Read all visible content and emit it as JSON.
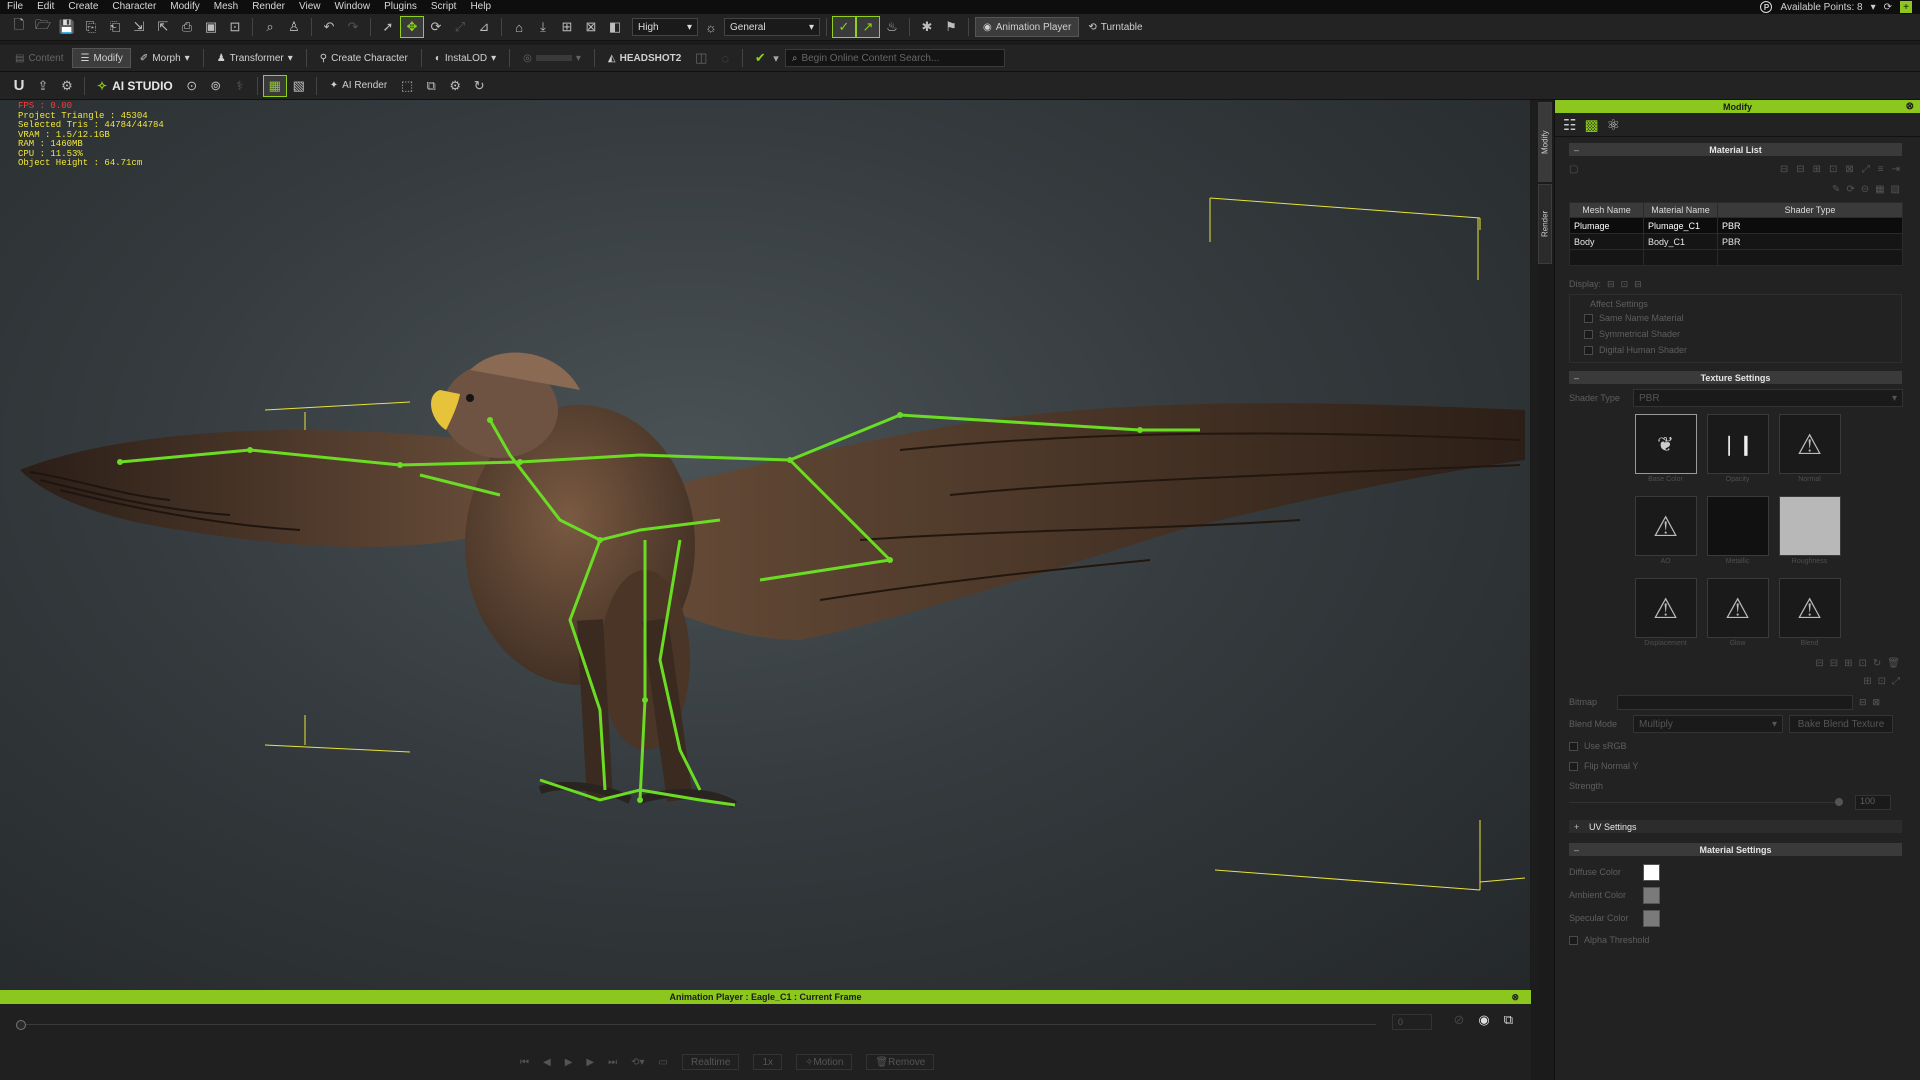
{
  "menu": [
    "File",
    "Edit",
    "Create",
    "Character",
    "Modify",
    "Mesh",
    "Render",
    "View",
    "Window",
    "Plugins",
    "Script",
    "Help"
  ],
  "account": {
    "points_label": "Available Points: 8",
    "points_icon_letter": "P"
  },
  "toolbar1": {
    "quality": "High",
    "mode": "General",
    "animation_player": "Animation Player",
    "turntable": "Turntable"
  },
  "toolbar2": {
    "content": "Content",
    "modify": "Modify",
    "morph": "Morph",
    "transformer": "Transformer",
    "create_character": "Create Character",
    "instalod": "InstaLOD",
    "headshot": "HEADSHOT2",
    "search_placeholder": "Begin Online Content Search..."
  },
  "toolbar3": {
    "u_label": "U",
    "ai_studio": "AI STUDIO",
    "ai_render": "AI Render"
  },
  "stats": {
    "fps": "FPS : 0.00",
    "project_triangle": "Project Triangle : 45304",
    "selected_tris": "Selected Tris : 44784/44784",
    "vram": "VRAM : 1.5/12.1GB",
    "ram": "RAM : 1460MB",
    "cpu": "CPU : 11.53%",
    "object_height": "Object Height : 64.71cm"
  },
  "side_tabs": {
    "modify": "Modify",
    "render": "Render"
  },
  "panel": {
    "title": "Modify",
    "material_list": {
      "title": "Material List",
      "headers": [
        "Mesh Name",
        "Material Name",
        "Shader Type"
      ],
      "rows": [
        [
          "Plumage",
          "Plumage_C1",
          "PBR"
        ],
        [
          "Body",
          "Body_C1",
          "PBR"
        ]
      ],
      "display_label": "Display:",
      "affect_settings": "Affect Settings",
      "options": [
        "Same Name Material",
        "Symmetrical Shader",
        "Digital Human Shader"
      ]
    },
    "texture_settings": {
      "title": "Texture Settings",
      "shader_type_label": "Shader Type",
      "shader_type_value": "PBR",
      "slots": [
        "Base Color",
        "Opacity",
        "Normal",
        "AO",
        "Metallic",
        "Roughness",
        "Displacement",
        "Glow",
        "Blend"
      ],
      "bitmap_label": "Bitmap",
      "blend_mode_label": "Blend Mode",
      "blend_mode_value": "Multiply",
      "bake_button": "Bake Blend Texture",
      "use_srgb": "Use sRGB",
      "flip_normal": "Flip Normal Y",
      "strength_label": "Strength",
      "strength_value": "100"
    },
    "uv_settings": {
      "title": "UV Settings"
    },
    "material_settings": {
      "title": "Material Settings",
      "diffuse": "Diffuse Color",
      "ambient": "Ambient Color",
      "specular": "Specular Color",
      "alpha": "Alpha Threshold",
      "diffuse_hex": "#ffffff",
      "ambient_hex": "#7a7a7a",
      "specular_hex": "#7a7a7a"
    }
  },
  "anim_player": {
    "title": "Animation Player : Eagle_C1 : Current Frame",
    "frame_value": "0",
    "realtime": "Realtime",
    "speed": "1x",
    "motion": "Motion",
    "remove": "Remove"
  },
  "colors": {
    "accent": "#8bc71c",
    "bone": "#6bdc24",
    "stats": "#f2e63a"
  }
}
